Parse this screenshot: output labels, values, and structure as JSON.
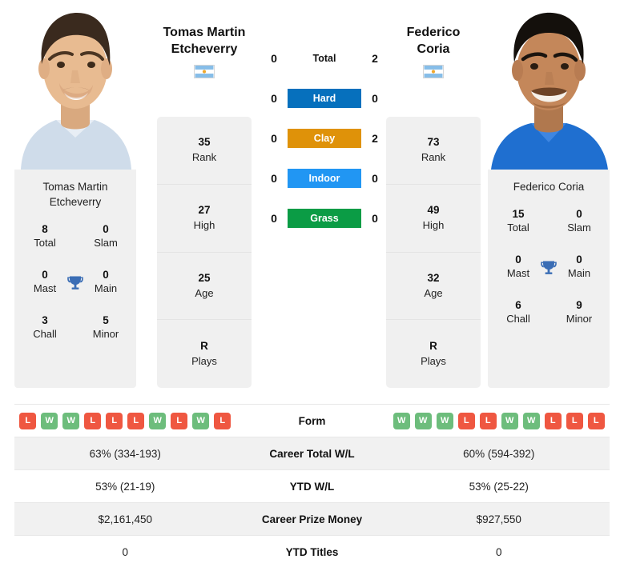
{
  "colors": {
    "hard": "#0670bd",
    "clay": "#df9209",
    "indoor": "#2196f3",
    "grass": "#0b9c45",
    "win": "#6dbd7c",
    "loss": "#ef5741",
    "trophy": "#3a6db5",
    "panel": "#f0f0f0",
    "row_shade": "#f1f1f1"
  },
  "players": {
    "left": {
      "headline_name": "Tomas Martin Etcheverry",
      "headline_line1": "Tomas Martin",
      "headline_line2": "Etcheverry",
      "flag_icon": "argentina-flag-icon",
      "flag_title": "Argentina",
      "card_name_line1": "Tomas Martin",
      "card_name_line2": "Etcheverry",
      "titles": [
        {
          "value": "8",
          "label": "Total"
        },
        {
          "value": "0",
          "label": "Slam"
        },
        {
          "value": "0",
          "label": "Mast"
        },
        {
          "value": "0",
          "label": "Main"
        },
        {
          "value": "3",
          "label": "Chall"
        },
        {
          "value": "5",
          "label": "Minor"
        }
      ],
      "trophy_icon": "trophy-icon",
      "stats": [
        {
          "value": "35",
          "label": "Rank"
        },
        {
          "value": "27",
          "label": "High"
        },
        {
          "value": "25",
          "label": "Age"
        },
        {
          "value": "R",
          "label": "Plays"
        }
      ],
      "form": [
        "L",
        "W",
        "W",
        "L",
        "L",
        "L",
        "W",
        "L",
        "W",
        "L"
      ],
      "career_total_wl": "63% (334-193)",
      "ytd_wl": "53% (21-19)",
      "career_prize_money": "$2,161,450",
      "ytd_titles": "0"
    },
    "right": {
      "headline_name": "Federico Coria",
      "headline_line1": "Federico",
      "headline_line2": "Coria",
      "flag_icon": "argentina-flag-icon",
      "flag_title": "Argentina",
      "card_name_line1": "Federico Coria",
      "card_name_line2": "",
      "titles": [
        {
          "value": "15",
          "label": "Total"
        },
        {
          "value": "0",
          "label": "Slam"
        },
        {
          "value": "0",
          "label": "Mast"
        },
        {
          "value": "0",
          "label": "Main"
        },
        {
          "value": "6",
          "label": "Chall"
        },
        {
          "value": "9",
          "label": "Minor"
        }
      ],
      "trophy_icon": "trophy-icon",
      "stats": [
        {
          "value": "73",
          "label": "Rank"
        },
        {
          "value": "49",
          "label": "High"
        },
        {
          "value": "32",
          "label": "Age"
        },
        {
          "value": "R",
          "label": "Plays"
        }
      ],
      "form": [
        "W",
        "W",
        "W",
        "L",
        "L",
        "W",
        "W",
        "L",
        "L",
        "L"
      ],
      "career_total_wl": "60% (594-392)",
      "ytd_wl": "53% (25-22)",
      "career_prize_money": "$927,550",
      "ytd_titles": "0"
    }
  },
  "head_to_head": [
    {
      "label": "Total",
      "left": "0",
      "right": "2",
      "style": "plain"
    },
    {
      "label": "Hard",
      "left": "0",
      "right": "0",
      "style": "hard"
    },
    {
      "label": "Clay",
      "left": "0",
      "right": "2",
      "style": "clay"
    },
    {
      "label": "Indoor",
      "left": "0",
      "right": "0",
      "style": "indoor"
    },
    {
      "label": "Grass",
      "left": "0",
      "right": "0",
      "style": "grass"
    }
  ],
  "comparison_rows": [
    {
      "label": "Form",
      "left": "",
      "right": ""
    },
    {
      "label": "Career Total W/L",
      "left": "63% (334-193)",
      "right": "60% (594-392)"
    },
    {
      "label": "YTD W/L",
      "left": "53% (21-19)",
      "right": "53% (25-22)"
    },
    {
      "label": "Career Prize Money",
      "left": "$2,161,450",
      "right": "$927,550"
    },
    {
      "label": "YTD Titles",
      "left": "0",
      "right": "0"
    }
  ]
}
